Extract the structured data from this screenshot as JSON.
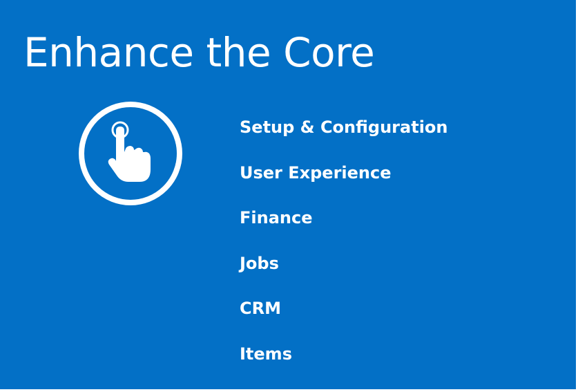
{
  "page": {
    "title": "Enhance the Core",
    "background_color": "#0370c6",
    "text_color": "#ffffff",
    "icon": "touch-hand-icon"
  },
  "menu": {
    "items": [
      {
        "label": "Setup & Configuration"
      },
      {
        "label": "User Experience"
      },
      {
        "label": "Finance"
      },
      {
        "label": "Jobs"
      },
      {
        "label": "CRM"
      },
      {
        "label": "Items"
      }
    ]
  }
}
